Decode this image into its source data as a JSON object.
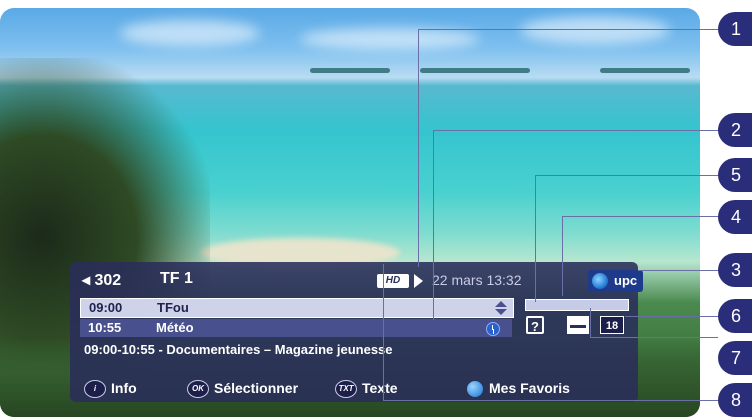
{
  "channel": {
    "number": "302",
    "name": "TF 1",
    "hd": "HD",
    "datetime": "22 mars 13:32",
    "logo": "upc"
  },
  "programs": [
    {
      "time": "09:00",
      "title": "TFou",
      "icon": "updown-icon"
    },
    {
      "time": "10:55",
      "title": "Météo",
      "icon": "clock-icon"
    }
  ],
  "description": "09:00-10:55 - Documentaires – Magazine jeunesse",
  "progress": {
    "fraction": 0.0
  },
  "indicators": {
    "help": "?",
    "age": "18"
  },
  "legend": {
    "info_key": "i",
    "info": "Info",
    "ok_key": "OK",
    "select": "Sélectionner",
    "txt_key": "TXT",
    "text": "Texte",
    "favorites": "Mes Favoris"
  },
  "callouts": [
    "1",
    "2",
    "5",
    "4",
    "3",
    "6",
    "7",
    "8"
  ],
  "colors": {
    "panel": "#2a2e5a",
    "callout": "#2a2e7a",
    "selected_row": "#cfd3ea",
    "leader": "#6a6fa6"
  }
}
